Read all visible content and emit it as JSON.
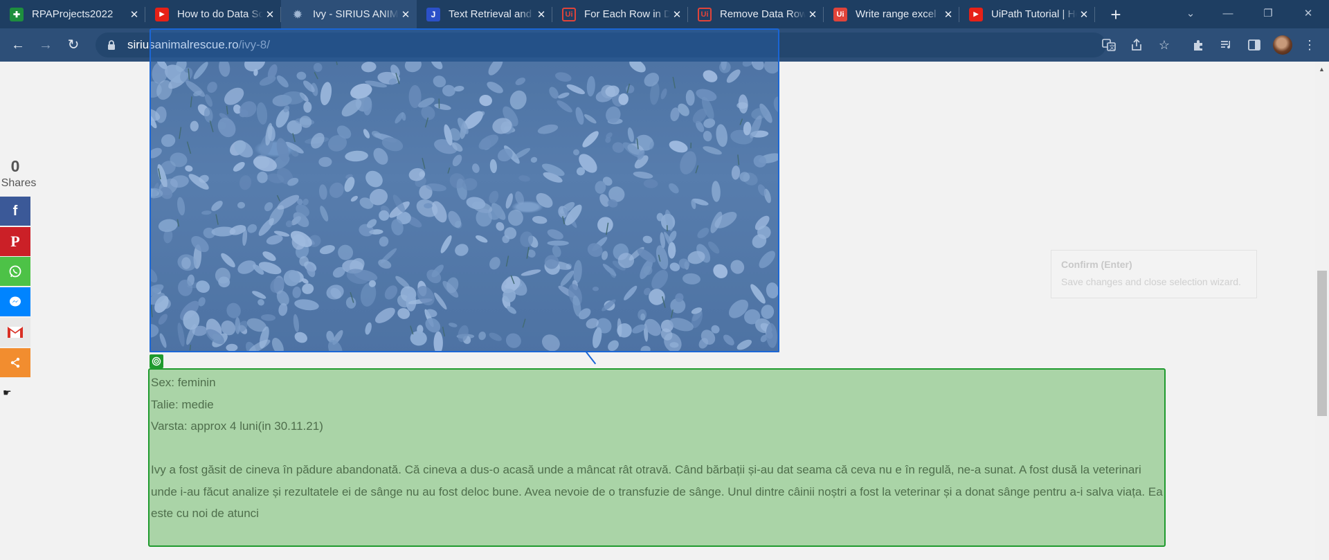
{
  "browser": {
    "tabs": [
      {
        "title": "RPAProjects2022",
        "icon": "sheets-icon",
        "active": false
      },
      {
        "title": "How to do Data Scraping",
        "icon": "youtube-icon",
        "active": false
      },
      {
        "title": "Ivy - SIRIUS ANIMAL RESCUE",
        "icon": "sirius-paw-icon",
        "active": true
      },
      {
        "title": "Text Retrieval and Search",
        "icon": "j-icon",
        "active": false
      },
      {
        "title": "For Each Row in Data Table",
        "icon": "uipath-icon",
        "active": false
      },
      {
        "title": "Remove Data Row",
        "icon": "uipath-icon",
        "active": false
      },
      {
        "title": "Write range excel",
        "icon": "uipath-icon",
        "active": false
      },
      {
        "title": "UiPath Tutorial | How to",
        "icon": "youtube-icon",
        "active": false
      }
    ],
    "new_tab": "+",
    "address": {
      "domain": "siriusanimalrescue.ro",
      "path": "/ivy-8/"
    },
    "colors": {
      "chrome": "#1e3e62",
      "active_tab": "#2d4f78"
    }
  },
  "share": {
    "count": "0",
    "label": "Shares",
    "buttons": [
      {
        "name": "facebook",
        "color": "#3b5998"
      },
      {
        "name": "pinterest",
        "color": "#cb2027"
      },
      {
        "name": "whatsapp",
        "color": "#4dc247"
      },
      {
        "name": "messenger",
        "color": "#0084ff"
      },
      {
        "name": "gmail",
        "color": "#e8e8e8"
      },
      {
        "name": "share-more",
        "color": "#f28d2f"
      }
    ]
  },
  "tooltip": {
    "title": "Confirm (Enter)",
    "description": "Save changes and close selection wizard."
  },
  "article": {
    "lines": [
      "Sex: feminin",
      "Talie: medie",
      "Varsta: approx 4 luni(in 30.11.21)"
    ],
    "paragraph": "Ivy a fost găsit de cineva în pădure abandonată. Că cineva a dus-o acasă unde a mâncat rât otravă. Când bărbații și-au dat seama că ceva nu e în regulă, ne-a sunat. A fost dusă la veterinari unde i-au făcut analize și rezultatele ei de sânge nu au fost deloc bune. Avea nevoie de o transfuzie de sânge. Unul dintre câinii noștri a fost la veterinar și a donat sânge pentru a-i salva viața. Ea este cu noi de atunci"
  },
  "selection": {
    "overlay_color": "#1a66d6",
    "target_color": "#1f9a2e"
  }
}
